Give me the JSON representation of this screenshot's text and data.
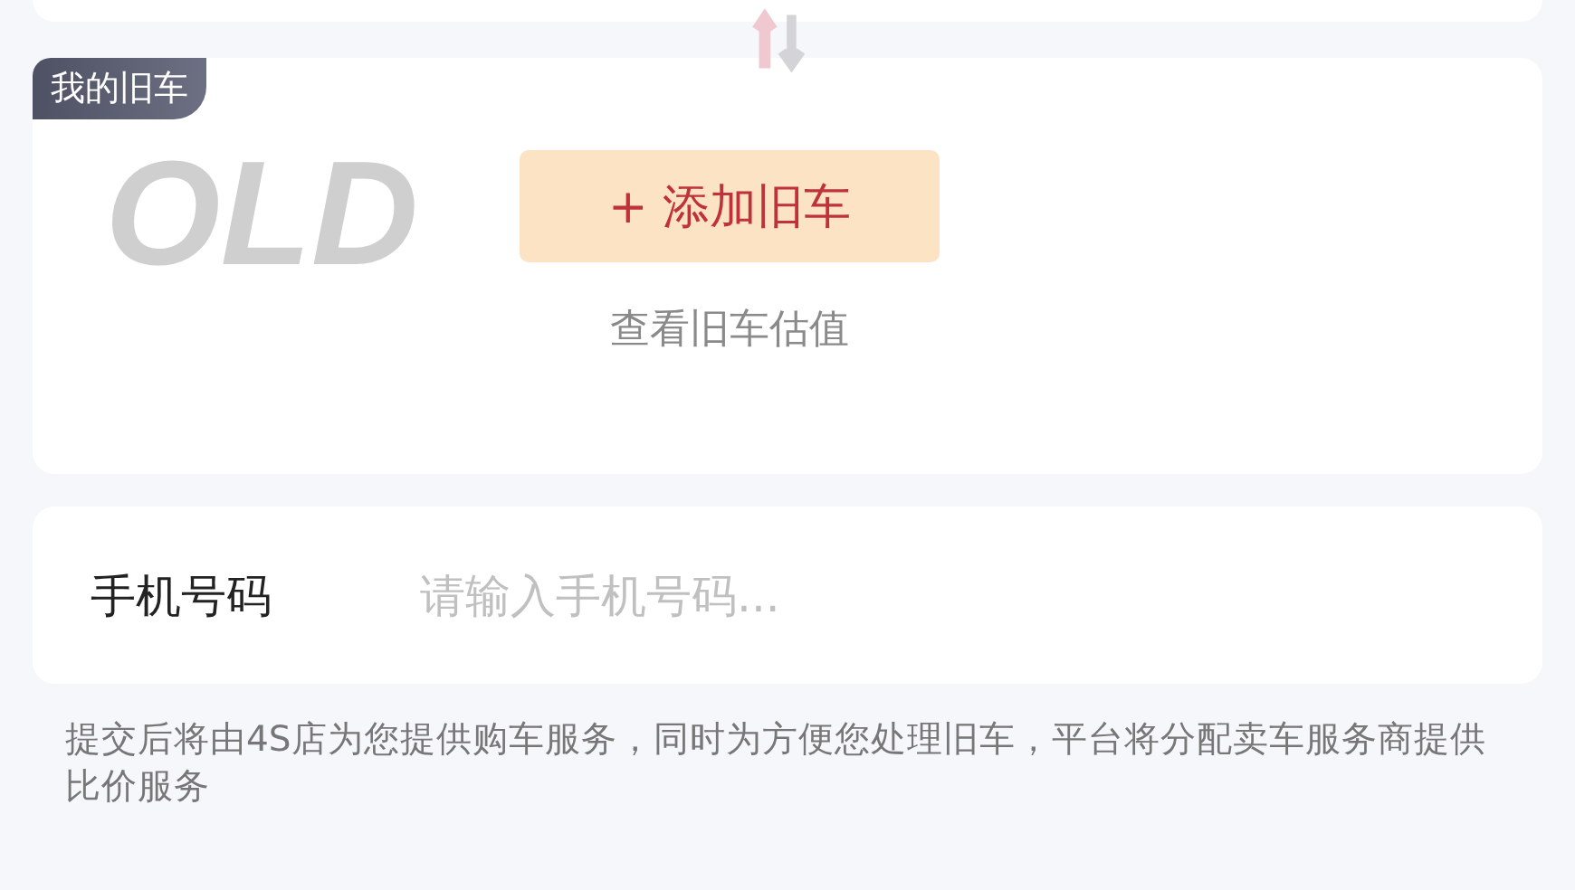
{
  "used_car": {
    "tag": "我的旧车",
    "decoration": "OLD",
    "add_button": "+ 添加旧车",
    "valuation_link": "查看旧车估值"
  },
  "phone": {
    "label": "手机号码",
    "placeholder": "请输入手机号码..."
  },
  "notice": "提交后将由4S店为您提供购车服务，同时为方便您处理旧车，平台将分配卖车服务商提供比价服务"
}
